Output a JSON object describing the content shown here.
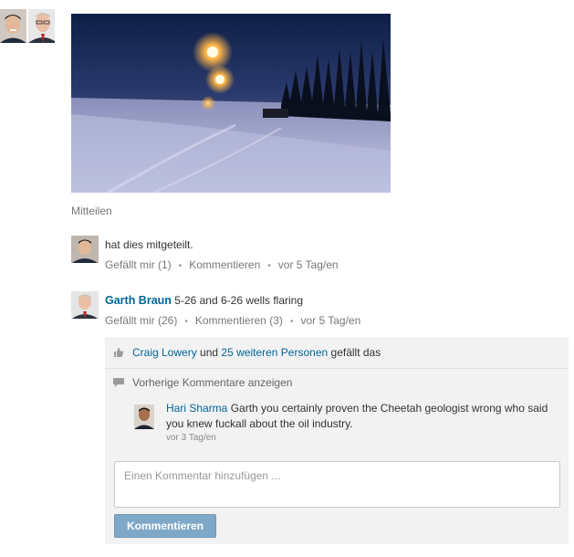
{
  "post": {
    "share_label": "Mitteilen"
  },
  "shared_activity": {
    "text": "hat dies mitgeteilt.",
    "like_label": "Gefällt mir (1)",
    "comment_label": "Kommentieren",
    "time": "vor 5 Tag/en"
  },
  "update": {
    "author": "Garth Braun",
    "text": "5-26 and 6-26 wells flaring",
    "like_label": "Gefällt mir (26)",
    "comment_label": "Kommentieren (3)",
    "time": "vor 5 Tag/en"
  },
  "likes": {
    "person": "Craig Lowery",
    "connector": "und",
    "others": "25 weiteren Personen",
    "suffix": "gefällt das"
  },
  "previous_comments_label": "Vorherige Kommentare anzeigen",
  "comment": {
    "author": "Hari Sharma",
    "text": "Garth you certainly proven the Cheetah geologist wrong who said you knew fuckall about the oil industry.",
    "time": "vor 3 Tag/en"
  },
  "comment_form": {
    "placeholder": "Einen Kommentar hinzufügen ...",
    "submit_label": "Kommentieren"
  },
  "colors": {
    "link": "#006699",
    "button": "#7fa8c8",
    "panel": "#f2f2f2"
  }
}
